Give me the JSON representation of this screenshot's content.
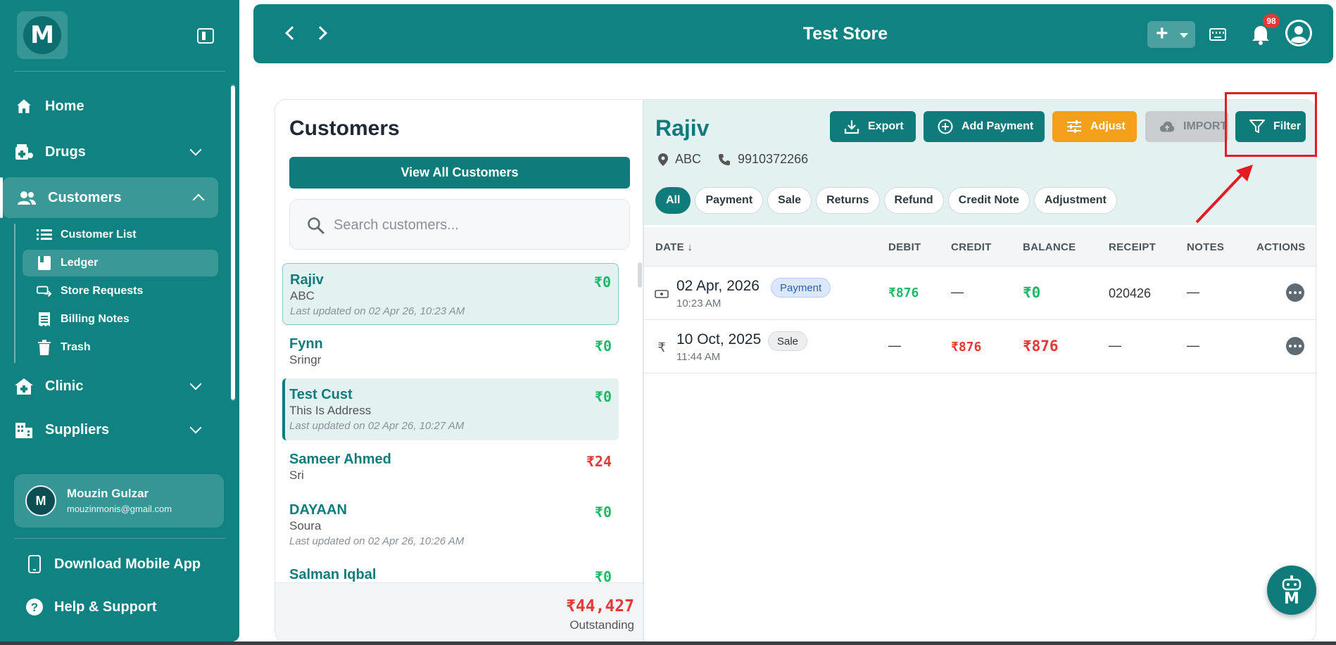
{
  "sidebar": {
    "logo_letter": "M",
    "nav": {
      "home": "Home",
      "drugs": "Drugs",
      "customers": "Customers",
      "clinic": "Clinic",
      "suppliers": "Suppliers"
    },
    "sub": {
      "customer_list": "Customer List",
      "ledger": "Ledger",
      "store_requests": "Store Requests",
      "billing_notes": "Billing Notes",
      "trash": "Trash"
    },
    "user": {
      "initial": "M",
      "name": "Mouzin Gulzar",
      "email": "mouzinmonis@gmail.com"
    },
    "footer": {
      "download": "Download Mobile App",
      "help": "Help & Support"
    }
  },
  "topbar": {
    "title": "Test Store",
    "add_label": "+",
    "notification_count": "98"
  },
  "customers": {
    "title": "Customers",
    "view_all": "View All Customers",
    "search_placeholder": "Search customers...",
    "list": [
      {
        "name": "Rajiv",
        "address": "ABC",
        "updated": "Last updated on 02 Apr 26, 10:23 AM",
        "balance": "₹0"
      },
      {
        "name": "Fynn",
        "address": "Sringr",
        "balance": "₹0"
      },
      {
        "name": "Test Cust",
        "address": "This Is Address",
        "updated": "Last updated on 02 Apr 26, 10:27 AM",
        "balance": "₹0"
      },
      {
        "name": "Sameer Ahmed",
        "address": "Sri",
        "balance": "₹24"
      },
      {
        "name": "DAYAAN",
        "address": "Soura",
        "updated": "Last updated on 02 Apr 26, 10:26 AM",
        "balance": "₹0"
      },
      {
        "name": "Salman Iqbal",
        "balance": "₹0"
      }
    ],
    "outstanding_value": "₹44,427",
    "outstanding_label": "Outstanding"
  },
  "ledger": {
    "name": "Rajiv",
    "address": "ABC",
    "phone": "9910372266",
    "buttons": {
      "export": "Export",
      "add_payment": "Add Payment",
      "adjust": "Adjust",
      "import": "IMPORT",
      "filter": "Filter"
    },
    "filters": [
      "All",
      "Payment",
      "Sale",
      "Returns",
      "Refund",
      "Credit Note",
      "Adjustment"
    ],
    "columns": {
      "date": "DATE ↓",
      "debit": "DEBIT",
      "credit": "CREDIT",
      "balance": "BALANCE",
      "receipt": "RECEIPT",
      "notes": "NOTES",
      "actions": "ACTIONS"
    },
    "rows": [
      {
        "date": "02 Apr, 2026",
        "time": "10:23 AM",
        "type": "Payment",
        "debit": "₹876",
        "credit": "—",
        "balance": "₹0",
        "receipt": "020426",
        "notes": "—"
      },
      {
        "date": "10 Oct, 2025",
        "time": "11:44 AM",
        "type": "Sale",
        "debit": "—",
        "credit": "₹876",
        "balance": "₹876",
        "receipt": "—",
        "notes": "—"
      }
    ]
  },
  "colors": {
    "primary": "#0f8281",
    "accent_orange": "#f5a01a",
    "positive": "#1fb86a",
    "negative": "#e53935",
    "annotation_red": "#e31b23"
  }
}
